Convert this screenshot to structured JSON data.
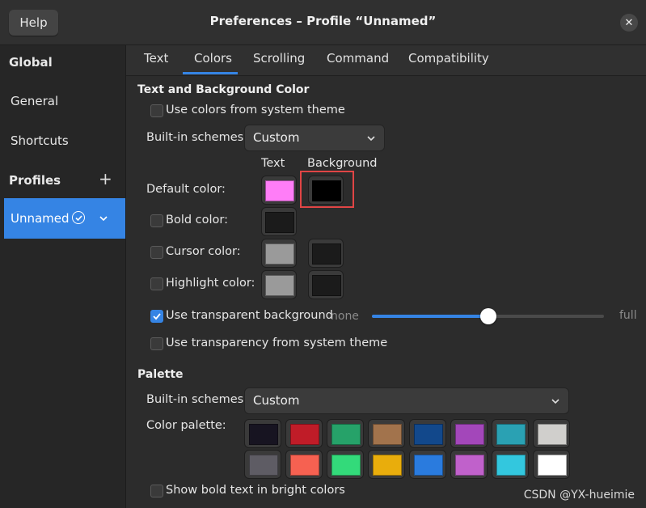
{
  "titlebar": {
    "help_label": "Help",
    "title": "Preferences – Profile “Unnamed”",
    "close_glyph": "✕"
  },
  "sidebar": {
    "global_heading": "Global",
    "items": [
      {
        "label": "General"
      },
      {
        "label": "Shortcuts"
      }
    ],
    "profiles_heading": "Profiles",
    "add_glyph": "+",
    "selected_profile": "Unnamed"
  },
  "tabs": [
    {
      "label": "Text"
    },
    {
      "label": "Colors"
    },
    {
      "label": "Scrolling"
    },
    {
      "label": "Command"
    },
    {
      "label": "Compatibility"
    }
  ],
  "active_tab": "Colors",
  "text_bg": {
    "section_title": "Text and Background Color",
    "use_system_theme_label": "Use colors from system theme",
    "builtin_schemes_label": "Built-in schemes:",
    "builtin_schemes_value": "Custom",
    "col_text": "Text",
    "col_background": "Background",
    "default_color_label": "Default color:",
    "default_text_color": "#ff7df7",
    "default_bg_color": "#000000",
    "bold_color_label": "Bold color:",
    "bold_color": "#1b1b1b",
    "cursor_color_label": "Cursor color:",
    "cursor_text_color": "#9a9a9a",
    "cursor_bg_color": "#1b1b1b",
    "highlight_color_label": "Highlight color:",
    "highlight_text_color": "#9a9a9a",
    "highlight_bg_color": "#1b1b1b",
    "transparent_label": "Use transparent background",
    "transparent_checked": true,
    "slider_min_label": "none",
    "slider_max_label": "full",
    "transparency_fraction": 0.5,
    "transparency_system_label": "Use transparency from system theme"
  },
  "palette": {
    "section_title": "Palette",
    "builtin_schemes_label": "Built-in schemes:",
    "builtin_schemes_value": "Custom",
    "color_palette_label": "Color palette:",
    "row1": [
      "#171421",
      "#c01c28",
      "#26a269",
      "#a2734c",
      "#12488b",
      "#a347ba",
      "#2aa1b3",
      "#d0cfcc"
    ],
    "row2": [
      "#5e5c64",
      "#f66151",
      "#33da7a",
      "#e9ad0c",
      "#2a7bde",
      "#c061cb",
      "#33c7de",
      "#ffffff"
    ],
    "bold_bright_label": "Show bold text in bright colors"
  },
  "colors": {
    "accent": "#3584e4",
    "highlight_box": "#e04545"
  },
  "watermark": "CSDN @YX-hueimie"
}
